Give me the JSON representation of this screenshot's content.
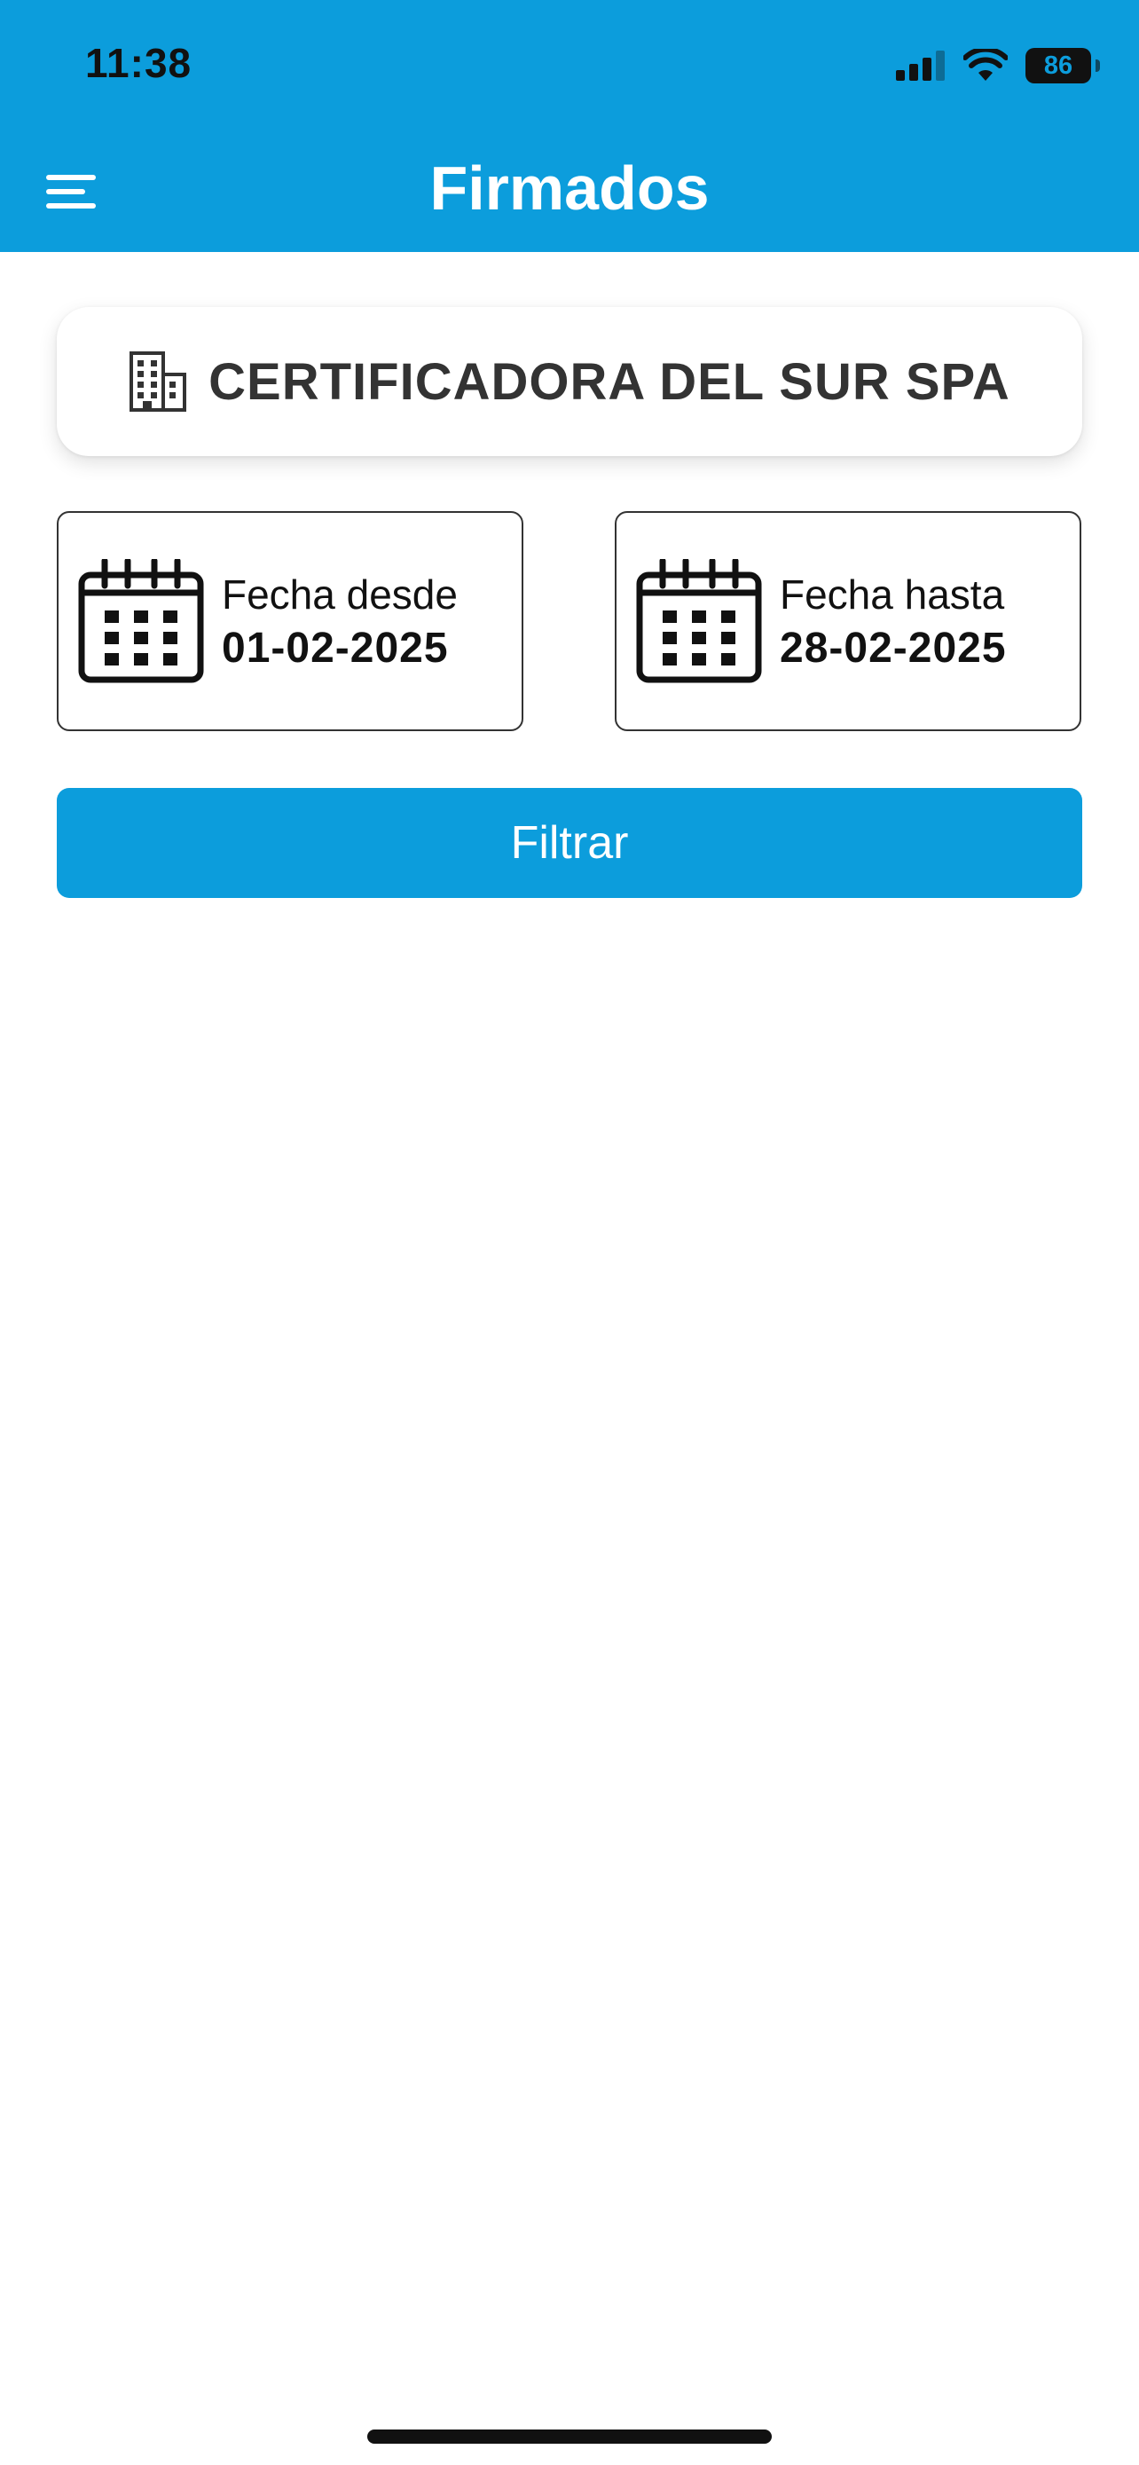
{
  "status_bar": {
    "time": "11:38",
    "battery_level": "86",
    "icons": [
      "cellular-signal-icon",
      "wifi-icon",
      "battery-icon"
    ]
  },
  "header": {
    "title": "Firmados",
    "menu_icon": "hamburger-menu-icon",
    "background_color": "#0c9ddc"
  },
  "company": {
    "icon": "building-icon",
    "name": "CERTIFICADORA DEL SUR SPA"
  },
  "date_from": {
    "icon": "calendar-icon",
    "label": "Fecha desde",
    "value": "01-02-2025"
  },
  "date_to": {
    "icon": "calendar-icon",
    "label": "Fecha hasta",
    "value": "28-02-2025"
  },
  "filter": {
    "label": "Filtrar",
    "color": "#0c9ddc"
  }
}
